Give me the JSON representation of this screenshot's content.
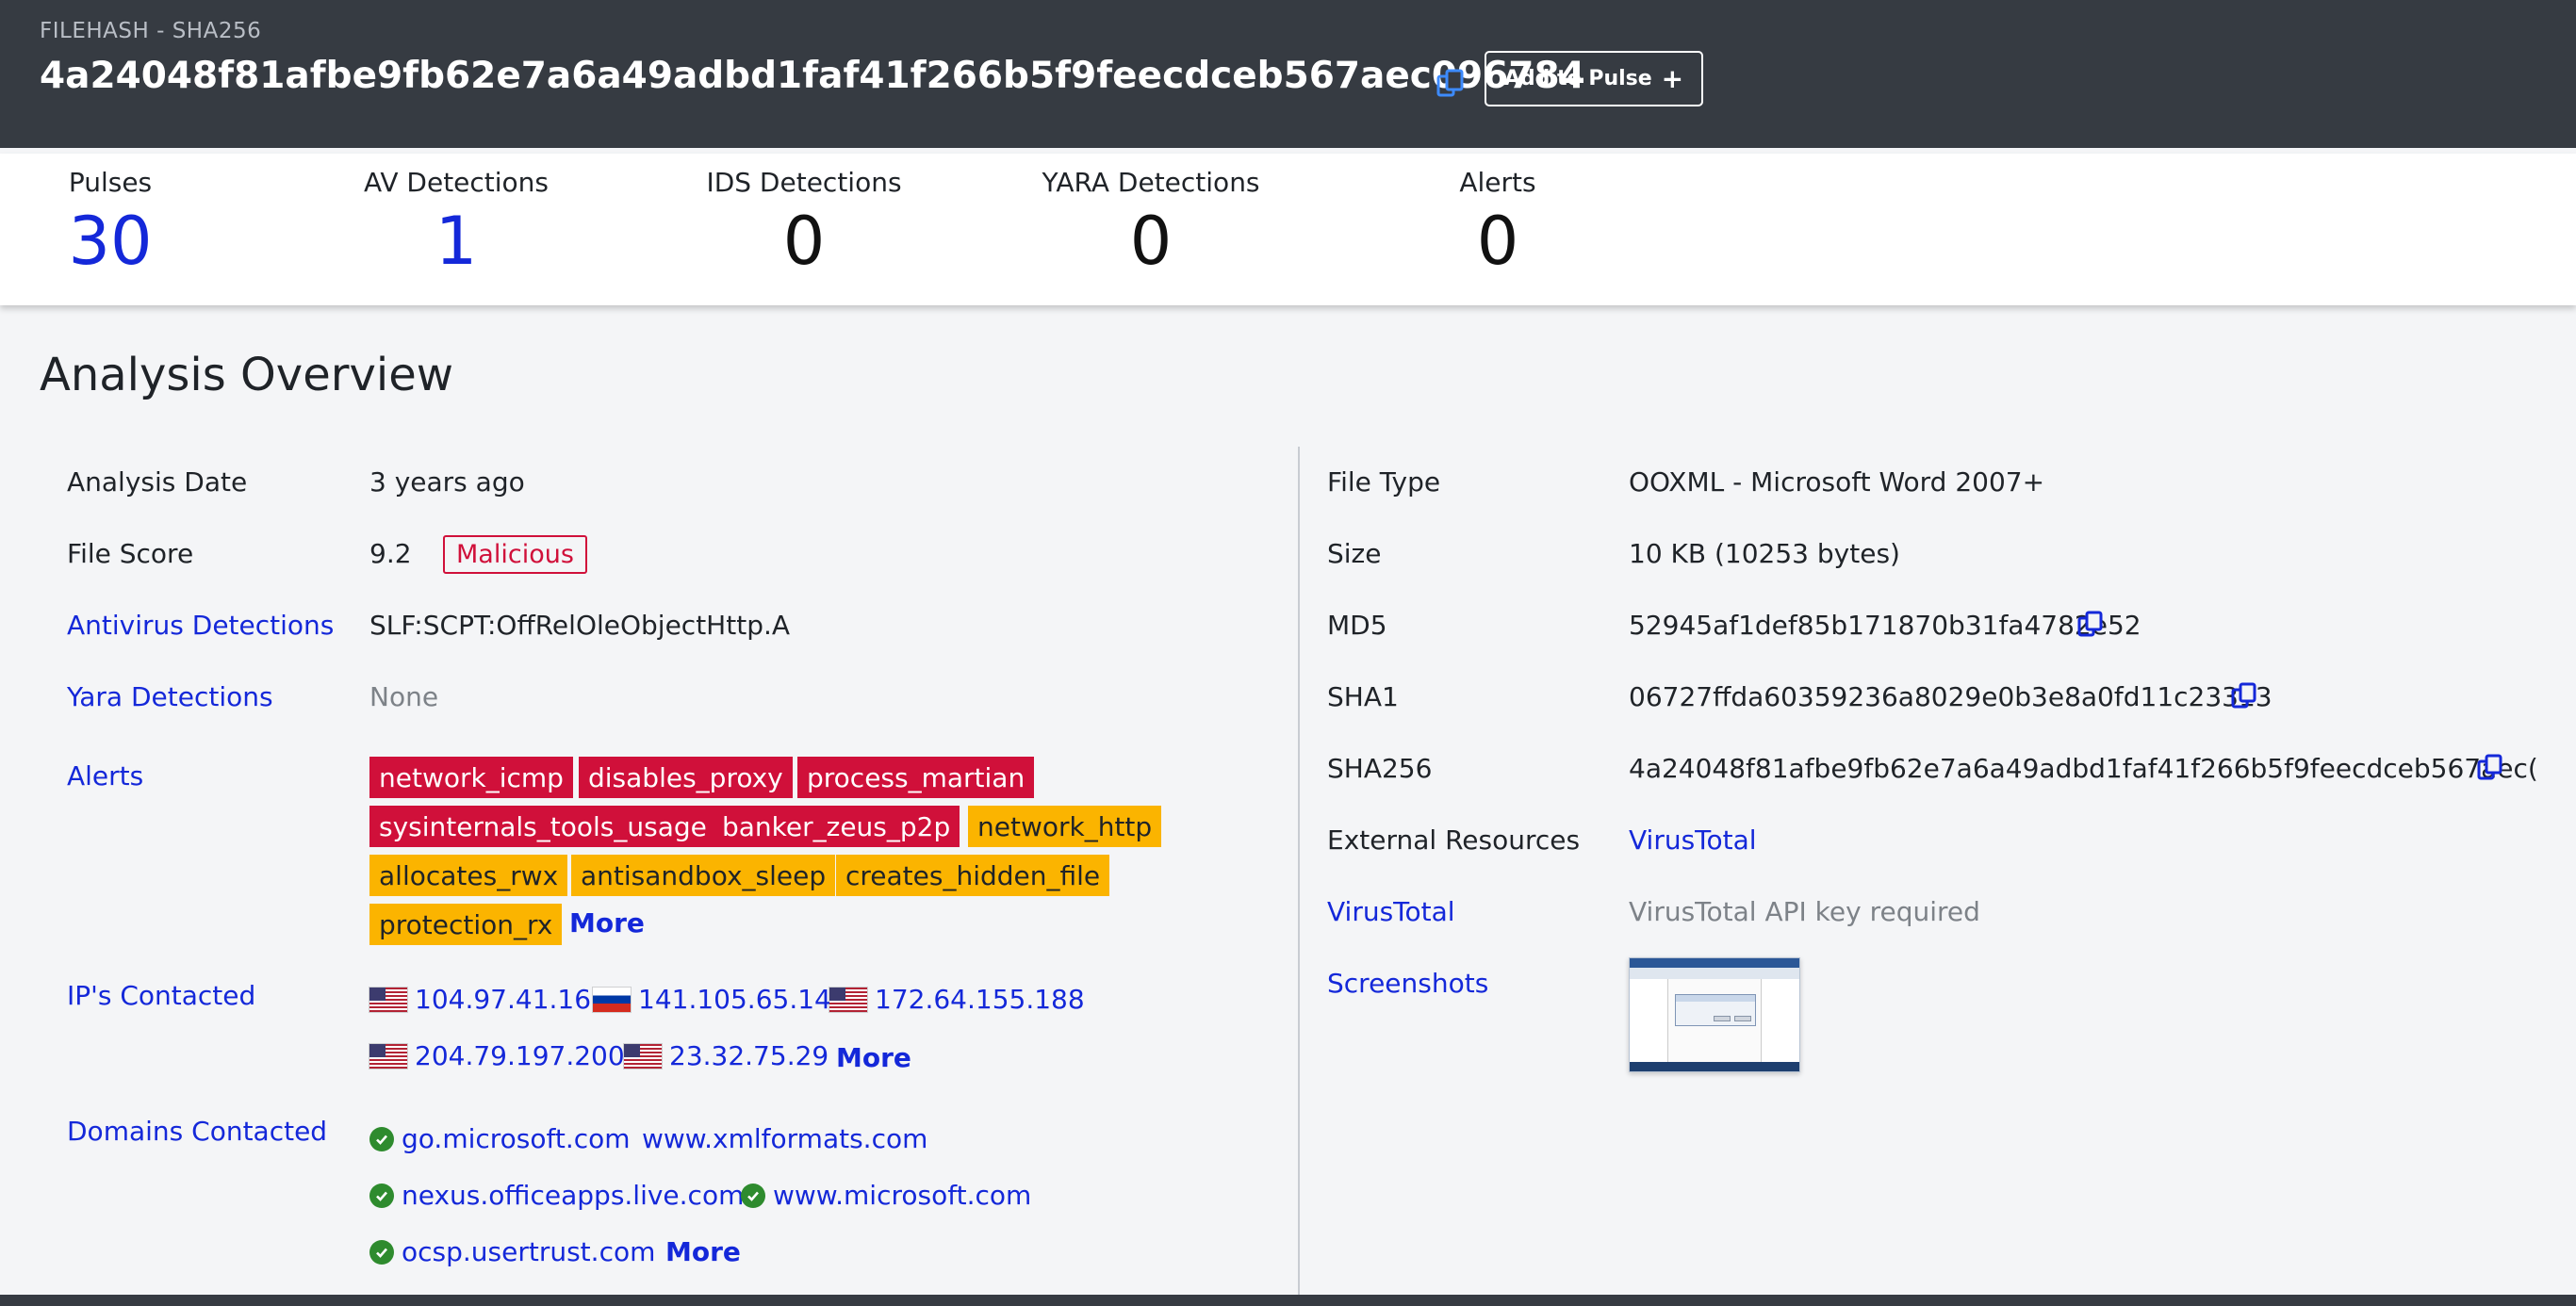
{
  "header": {
    "label": "FILEHASH - SHA256",
    "hash": "4a24048f81afbe9fb62e7a6a49adbd1faf41f266b5f9feecdceb567aec096784",
    "add_to_pulse": "Add to Pulse",
    "add_icon": "+"
  },
  "stats": [
    {
      "label": "Pulses",
      "value": "30",
      "highlight": true
    },
    {
      "label": "AV Detections",
      "value": "1",
      "highlight": true
    },
    {
      "label": "IDS Detections",
      "value": "0",
      "highlight": false
    },
    {
      "label": "YARA Detections",
      "value": "0",
      "highlight": false
    },
    {
      "label": "Alerts",
      "value": "0",
      "highlight": false
    }
  ],
  "section_title": "Analysis Overview",
  "left": {
    "analysis_date_label": "Analysis Date",
    "analysis_date": "3 years ago",
    "file_score_label": "File Score",
    "file_score": "9.2",
    "verdict": "Malicious",
    "av_label": "Antivirus Detections",
    "av_value": "SLF:SCPT:OffRelOleObjectHttp.A",
    "yara_label": "Yara Detections",
    "yara_value": "None",
    "alerts_label": "Alerts",
    "alerts": [
      {
        "name": "network_icmp",
        "severity": "high"
      },
      {
        "name": "disables_proxy",
        "severity": "high"
      },
      {
        "name": "process_martian",
        "severity": "high"
      },
      {
        "name": "sysinternals_tools_usage",
        "severity": "high"
      },
      {
        "name": "banker_zeus_p2p",
        "severity": "high"
      },
      {
        "name": "network_http",
        "severity": "medium"
      },
      {
        "name": "allocates_rwx",
        "severity": "medium"
      },
      {
        "name": "antisandbox_sleep",
        "severity": "medium"
      },
      {
        "name": "creates_hidden_file",
        "severity": "medium"
      },
      {
        "name": "protection_rx",
        "severity": "medium"
      }
    ],
    "alerts_more": "More",
    "ips_label": "IP's Contacted",
    "ips": [
      {
        "ip": "104.97.41.163",
        "flag": "us-flag-icon"
      },
      {
        "ip": "141.105.65.149",
        "flag": "ru-flag-icon"
      },
      {
        "ip": "172.64.155.188",
        "flag": "us-flag-icon"
      },
      {
        "ip": "204.79.197.200",
        "flag": "us-flag-icon"
      },
      {
        "ip": "23.32.75.29",
        "flag": "us-flag-icon"
      }
    ],
    "ips_more": "More",
    "domains_label": "Domains Contacted",
    "domains": [
      {
        "domain": "go.microsoft.com",
        "verified": true
      },
      {
        "domain": "www.xmlformats.com",
        "verified": false
      },
      {
        "domain": "nexus.officeapps.live.com",
        "verified": true
      },
      {
        "domain": "www.microsoft.com",
        "verified": true
      },
      {
        "domain": "ocsp.usertrust.com",
        "verified": true
      }
    ],
    "domains_more": "More"
  },
  "right": {
    "file_type_label": "File Type",
    "file_type": "OOXML - Microsoft Word 2007+",
    "size_label": "Size",
    "size": "10 KB (10253 bytes)",
    "md5_label": "MD5",
    "md5": "52945af1def85b171870b31fa4782e52",
    "sha1_label": "SHA1",
    "sha1": "06727ffda60359236a8029e0b3e8a0fd11c23313",
    "sha256_label": "SHA256",
    "sha256": "4a24048f81afbe9fb62e7a6a49adbd1faf41f266b5f9feecdceb567aec(",
    "ext_label": "External Resources",
    "ext_link": "VirusTotal",
    "vt_label": "VirusTotal",
    "vt_value": "VirusTotal API key required",
    "screens_label": "Screenshots"
  },
  "colors": {
    "header_bg": "#363b42",
    "link_blue": "#1428d9",
    "alert_red": "#d0103a",
    "alert_orange": "#fbb400",
    "verified_green": "#2e8b2e"
  }
}
